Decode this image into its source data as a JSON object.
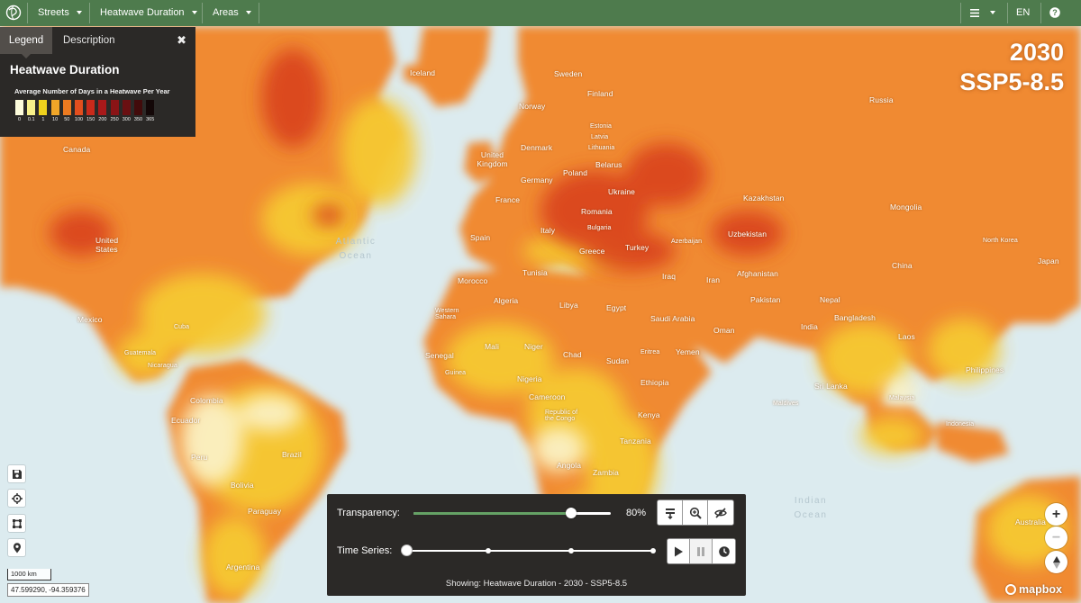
{
  "colors": {
    "topbar": "#4e7b4d",
    "panel": "#2b2927",
    "ocean": "#dcebef",
    "accent_green": "#65a265"
  },
  "topbar": {
    "logo_icon": "globe-logo-icon",
    "items": [
      {
        "label": "Streets"
      },
      {
        "label": "Heatwave Duration"
      },
      {
        "label": "Areas"
      }
    ],
    "menu_icon": "hamburger-icon",
    "language": "EN",
    "help_icon": "help-icon"
  },
  "scenario": {
    "year": "2030",
    "pathway": "SSP5-8.5"
  },
  "legend": {
    "tabs": [
      {
        "label": "Legend",
        "active": true
      },
      {
        "label": "Description",
        "active": false
      }
    ],
    "close_icon": "close-icon",
    "title": "Heatwave Duration",
    "subtitle": "Average Number of Days in a Heatwave Per Year",
    "classes": [
      {
        "label": "0",
        "color": "#fdfcdc"
      },
      {
        "label": "0.1",
        "color": "#f7f08a"
      },
      {
        "label": "1",
        "color": "#efd21d"
      },
      {
        "label": "10",
        "color": "#f1a628"
      },
      {
        "label": "50",
        "color": "#ec7a20"
      },
      {
        "label": "100",
        "color": "#e34e1e"
      },
      {
        "label": "150",
        "color": "#c92a1b"
      },
      {
        "label": "200",
        "color": "#a8191a"
      },
      {
        "label": "250",
        "color": "#8a1416"
      },
      {
        "label": "300",
        "color": "#6a1012"
      },
      {
        "label": "350",
        "color": "#420b0b"
      },
      {
        "label": "365",
        "color": "#130707"
      }
    ]
  },
  "map": {
    "labels": [
      {
        "name": "Iceland"
      },
      {
        "name": "Sweden"
      },
      {
        "name": "Finland"
      },
      {
        "name": "Norway"
      },
      {
        "name": "Russia"
      },
      {
        "name": "Estonia"
      },
      {
        "name": "Latvia"
      },
      {
        "name": "Lithuania"
      },
      {
        "name": "Denmark"
      },
      {
        "name": "Belarus"
      },
      {
        "name": "United Kingdom"
      },
      {
        "name": "Germany"
      },
      {
        "name": "Poland"
      },
      {
        "name": "Ukraine"
      },
      {
        "name": "France"
      },
      {
        "name": "Kazakhstan"
      },
      {
        "name": "Mongolia"
      },
      {
        "name": "Romania"
      },
      {
        "name": "Bulgaria"
      },
      {
        "name": "Italy"
      },
      {
        "name": "Spain"
      },
      {
        "name": "Greece"
      },
      {
        "name": "Turkey"
      },
      {
        "name": "Azerbaijan"
      },
      {
        "name": "Uzbekistan"
      },
      {
        "name": "Canada"
      },
      {
        "name": "United States"
      },
      {
        "name": "North Korea"
      },
      {
        "name": "Japan"
      },
      {
        "name": "China"
      },
      {
        "name": "Tunisia"
      },
      {
        "name": "Morocco"
      },
      {
        "name": "Algeria"
      },
      {
        "name": "Libya"
      },
      {
        "name": "Egypt"
      },
      {
        "name": "Iraq"
      },
      {
        "name": "Iran"
      },
      {
        "name": "Afghanistan"
      },
      {
        "name": "Pakistan"
      },
      {
        "name": "Nepal"
      },
      {
        "name": "Bangladesh"
      },
      {
        "name": "India"
      },
      {
        "name": "Saudi Arabia"
      },
      {
        "name": "Oman"
      },
      {
        "name": "Yemen"
      },
      {
        "name": "Laos"
      },
      {
        "name": "Philippines"
      },
      {
        "name": "Mexico"
      },
      {
        "name": "Cuba"
      },
      {
        "name": "Western Sahara"
      },
      {
        "name": "Mali"
      },
      {
        "name": "Niger"
      },
      {
        "name": "Chad"
      },
      {
        "name": "Sudan"
      },
      {
        "name": "Eritrea"
      },
      {
        "name": "Senegal"
      },
      {
        "name": "Guatemala"
      },
      {
        "name": "Nicaragua"
      },
      {
        "name": "Guinea"
      },
      {
        "name": "Nigeria"
      },
      {
        "name": "Ethiopia"
      },
      {
        "name": "Sri Lanka"
      },
      {
        "name": "Malaysia"
      },
      {
        "name": "Cameroon"
      },
      {
        "name": "Republic of the Congo"
      },
      {
        "name": "Kenya"
      },
      {
        "name": "Colombia"
      },
      {
        "name": "Ecuador"
      },
      {
        "name": "Maldives"
      },
      {
        "name": "Indonesia"
      },
      {
        "name": "Tanzania"
      },
      {
        "name": "Angola"
      },
      {
        "name": "Zambia"
      },
      {
        "name": "Peru"
      },
      {
        "name": "Brazil"
      },
      {
        "name": "Bolivia"
      },
      {
        "name": "Paraguay"
      },
      {
        "name": "Australia"
      },
      {
        "name": "Argentina"
      },
      {
        "name": "Atlantic Ocean"
      },
      {
        "name": "Indian Ocean"
      }
    ]
  },
  "tools": [
    {
      "icon": "save-icon"
    },
    {
      "icon": "crosshair-icon"
    },
    {
      "icon": "crop-icon"
    },
    {
      "icon": "map-pin-icon"
    }
  ],
  "scale": "1000 km",
  "coordinates": "47.599290, -94.359376",
  "zoom": {
    "in_icon": "plus-icon",
    "out_icon": "minus-icon",
    "compass_icon": "compass-icon"
  },
  "attribution": "mapbox",
  "controls": {
    "transparency_label": "Transparency:",
    "transparency_value": "80%",
    "transparency_fraction": 0.8,
    "transparency_buttons": [
      "layers-icon",
      "zoom-in-icon",
      "eye-off-icon"
    ],
    "timeseries_label": "Time Series:",
    "timeseries_steps": 4,
    "timeseries_index": 0,
    "timeseries_buttons": [
      "play-icon",
      "pause-icon",
      "clock-icon"
    ],
    "showing": "Showing: Heatwave Duration - 2030 - SSP5-8.5"
  }
}
